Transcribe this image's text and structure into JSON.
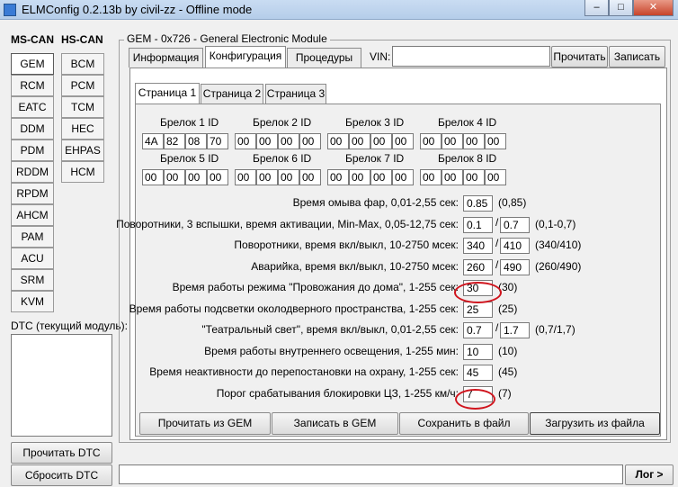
{
  "window": {
    "title": "ELMConfig 0.2.13b by civil-zz - Offline mode",
    "minimize": "–",
    "maximize": "□",
    "close": "✕"
  },
  "sidebar": {
    "ms_can_label": "MS-CAN",
    "hs_can_label": "HS-CAN",
    "ms_can_modules": [
      "GEM",
      "RCM",
      "EATC",
      "DDM",
      "PDM",
      "RDDM",
      "RPDM",
      "AHCM",
      "PAM",
      "ACU",
      "SRM",
      "KVM"
    ],
    "hs_can_modules": [
      "BCM",
      "PCM",
      "TCM",
      "HEC",
      "EHPAS",
      "HCM"
    ],
    "active_module": "GEM",
    "dtc_label": "DTC (текущий модуль):",
    "read_dtc": "Прочитать DTC",
    "reset_dtc": "Сбросить DTC"
  },
  "module_panel": {
    "title": "GEM - 0x726 - General Electronic Module",
    "tabs": [
      "Информация",
      "Конфигурация",
      "Процедуры"
    ],
    "active_tab": "Конфигурация",
    "vin_label": "VIN:",
    "vin_value": "",
    "read_button": "Прочитать",
    "write_button": "Записать"
  },
  "pages": {
    "tabs": [
      "Страница 1",
      "Страница 2",
      "Страница 3"
    ],
    "active": "Страница 1"
  },
  "keyfobs": [
    {
      "label": "Брелок 1 ID",
      "bytes": [
        "4A",
        "82",
        "08",
        "70"
      ]
    },
    {
      "label": "Брелок 2 ID",
      "bytes": [
        "00",
        "00",
        "00",
        "00"
      ]
    },
    {
      "label": "Брелок 3 ID",
      "bytes": [
        "00",
        "00",
        "00",
        "00"
      ]
    },
    {
      "label": "Брелок 4 ID",
      "bytes": [
        "00",
        "00",
        "00",
        "00"
      ]
    },
    {
      "label": "Брелок 5 ID",
      "bytes": [
        "00",
        "00",
        "00",
        "00"
      ]
    },
    {
      "label": "Брелок 6 ID",
      "bytes": [
        "00",
        "00",
        "00",
        "00"
      ]
    },
    {
      "label": "Брелок 7 ID",
      "bytes": [
        "00",
        "00",
        "00",
        "00"
      ]
    },
    {
      "label": "Брелок 8 ID",
      "bytes": [
        "00",
        "00",
        "00",
        "00"
      ]
    }
  ],
  "params": [
    {
      "label": "Время омыва фар, 0,01-2,55 сек:",
      "v1": "0.85",
      "v2": null,
      "hint": "(0,85)"
    },
    {
      "label": "Поворотники, 3 вспышки, время активации, Min-Max, 0,05-12,75 сек:",
      "v1": "0.1",
      "v2": "0.7",
      "hint": "(0,1-0,7)"
    },
    {
      "label": "Поворотники, время вкл/выкл, 10-2750 мсек:",
      "v1": "340",
      "v2": "410",
      "hint": "(340/410)"
    },
    {
      "label": "Аварийка, время вкл/выкл, 10-2750 мсек:",
      "v1": "260",
      "v2": "490",
      "hint": "(260/490)"
    },
    {
      "label": "Время работы режима \"Провожания до дома\", 1-255 сек:",
      "v1": "30",
      "v2": null,
      "hint": "(30)"
    },
    {
      "label": "Время работы подсветки околодверного пространства, 1-255 сек:",
      "v1": "25",
      "v2": null,
      "hint": "(25)"
    },
    {
      "label": "\"Театральный свет\", время вкл/выкл, 0,01-2,55 сек:",
      "v1": "0.7",
      "v2": "1.7",
      "hint": "(0,7/1,7)"
    },
    {
      "label": "Время работы внутреннего освещения, 1-255 мин:",
      "v1": "10",
      "v2": null,
      "hint": "(10)"
    },
    {
      "label": "Время неактивности до перепостановки на охрану, 1-255 сек:",
      "v1": "45",
      "v2": null,
      "hint": "(45)"
    },
    {
      "label": "Порог срабатывания блокировки ЦЗ, 1-255 км/ч:",
      "v1": "7",
      "v2": null,
      "hint": "(7)"
    }
  ],
  "actions": {
    "read_from_gem": "Прочитать из GEM",
    "write_to_gem": "Записать в GEM",
    "save_to_file": "Сохранить в файл",
    "load_from_file": "Загрузить из файла"
  },
  "footer": {
    "log_button": "Лог >"
  },
  "colors": {
    "highlight_ellipse": "#d0141d"
  }
}
